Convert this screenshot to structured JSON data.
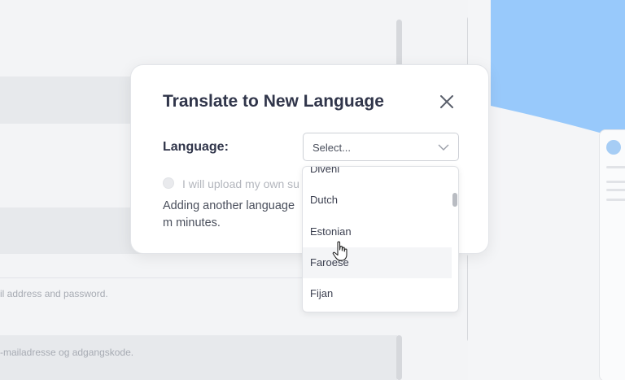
{
  "background": {
    "hint_line_1": "il address and password.",
    "hint_line_2": "-mailadresse og adgangskode."
  },
  "modal": {
    "title": "Translate to New Language",
    "language_label": "Language:",
    "select": {
      "value": "Select..."
    },
    "upload_checkbox_label": "I will upload my own su",
    "info_text": "Adding another language m minutes."
  },
  "dropdown": {
    "options": [
      {
        "label": "Divehi"
      },
      {
        "label": "Dutch"
      },
      {
        "label": "Estonian"
      },
      {
        "label": "Faroese"
      },
      {
        "label": "Fijan"
      }
    ],
    "hovered_option": "Faroese",
    "scroll_position_fraction": 0.2
  },
  "colors": {
    "accent_blue": "#98c9fb",
    "modal_bg": "#ffffff",
    "title_text": "#30354a"
  },
  "icons": {
    "close": "close-icon",
    "select_chevron": "chevron-down-icon",
    "cursor": "hand-pointer-icon"
  }
}
